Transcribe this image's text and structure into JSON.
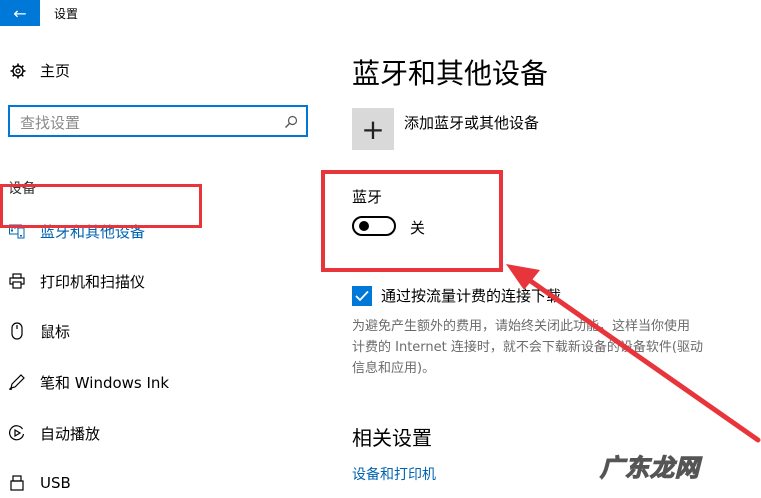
{
  "window": {
    "title": "设置"
  },
  "sidebar": {
    "home_label": "主页",
    "search_placeholder": "查找设置",
    "section_label": "设备",
    "items": [
      {
        "label": "蓝牙和其他设备",
        "icon": "bluetooth-device-icon",
        "active": true
      },
      {
        "label": "打印机和扫描仪",
        "icon": "printer-icon"
      },
      {
        "label": "鼠标",
        "icon": "mouse-icon"
      },
      {
        "label": "笔和 Windows Ink",
        "icon": "pen-icon"
      },
      {
        "label": "自动播放",
        "icon": "autoplay-icon"
      },
      {
        "label": "USB",
        "icon": "usb-icon"
      }
    ]
  },
  "main": {
    "page_title": "蓝牙和其他设备",
    "add_device_label": "添加蓝牙或其他设备",
    "bluetooth_label": "蓝牙",
    "bluetooth_state": "关",
    "metered_label": "通过按流量计费的连接下载",
    "metered_checked": true,
    "description_lines": [
      "为避免产生额外的费用，请始终关闭此功能，这样当你使用",
      "计费的 Internet 连接时，就不会下载新设备的设备软件(驱动",
      "信息和应用)。"
    ],
    "related_title": "相关设置",
    "related_link": "设备和打印机"
  },
  "watermark": "广东龙网",
  "colors": {
    "accent": "#0078d7",
    "link": "#0063b1",
    "annotation": "#e8353b"
  }
}
